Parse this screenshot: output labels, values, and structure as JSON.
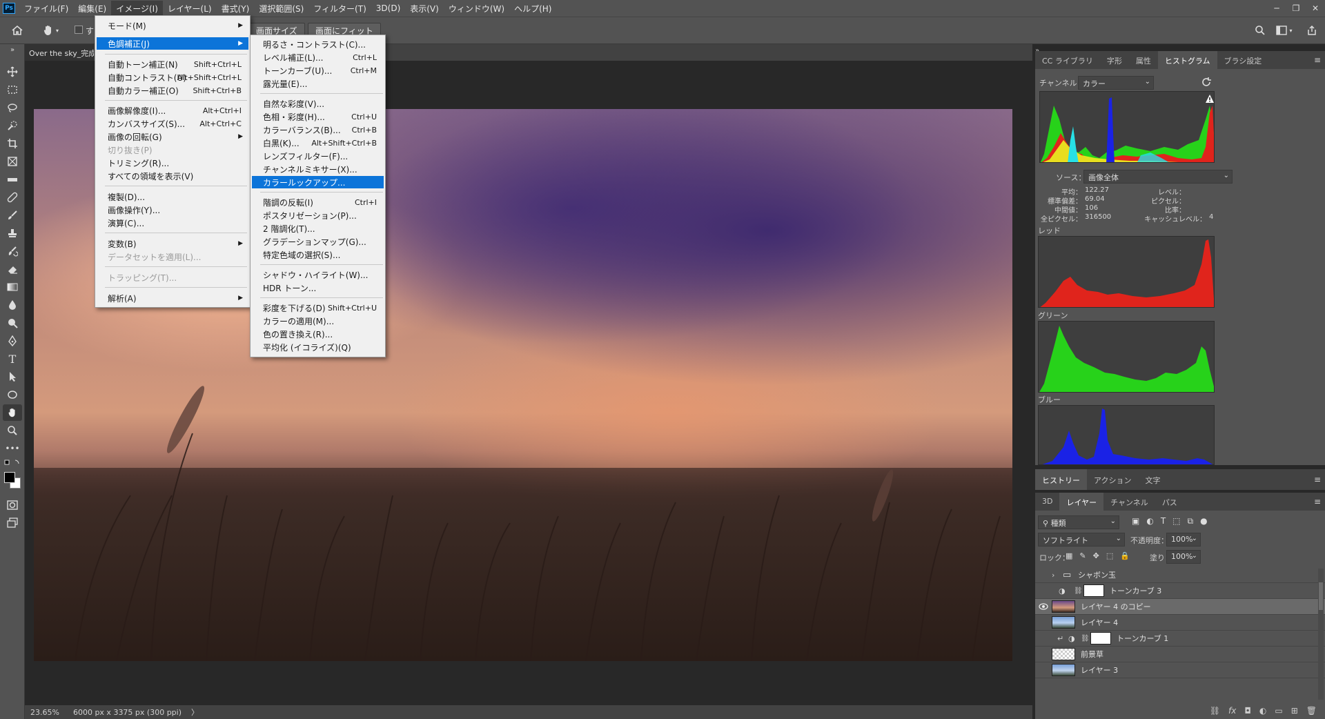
{
  "app": {
    "logo": "Ps"
  },
  "menubar": {
    "items": [
      "ファイル(F)",
      "編集(E)",
      "イメージ(I)",
      "レイヤー(L)",
      "書式(Y)",
      "選択範囲(S)",
      "フィルター(T)",
      "3D(D)",
      "表示(V)",
      "ウィンドウ(W)",
      "ヘルプ(H)"
    ],
    "window_controls": [
      "─",
      "❐",
      "✕"
    ]
  },
  "options": {
    "home_icon": "home-icon",
    "hand_icon": "hand-icon",
    "checkbox_label": "す",
    "btn_fit_size": "画面サイズ",
    "btn_fit_screen": "画面にフィット"
  },
  "document": {
    "tab_title": "Over the sky_完成",
    "zoom": "23.65%",
    "dimensions": "6000 px x 3375 px (300 ppi)",
    "status_arrow": "〉"
  },
  "image_menu": {
    "items": [
      {
        "label": "モード(M)",
        "submenu": true
      },
      {
        "label": "色調補正(J)",
        "submenu": true,
        "highlight": true
      },
      {
        "label": "自動トーン補正(N)",
        "shortcut": "Shift+Ctrl+L"
      },
      {
        "label": "自動コントラスト(U)",
        "shortcut": "Alt+Shift+Ctrl+L"
      },
      {
        "label": "自動カラー補正(O)",
        "shortcut": "Shift+Ctrl+B"
      },
      {
        "label": "画像解像度(I)...",
        "shortcut": "Alt+Ctrl+I"
      },
      {
        "label": "カンバスサイズ(S)...",
        "shortcut": "Alt+Ctrl+C"
      },
      {
        "label": "画像の回転(G)",
        "submenu": true
      },
      {
        "label": "切り抜き(P)",
        "disabled": true
      },
      {
        "label": "トリミング(R)..."
      },
      {
        "label": "すべての領域を表示(V)"
      },
      {
        "label": "複製(D)..."
      },
      {
        "label": "画像操作(Y)..."
      },
      {
        "label": "演算(C)..."
      },
      {
        "label": "変数(B)",
        "submenu": true
      },
      {
        "label": "データセットを適用(L)...",
        "disabled": true
      },
      {
        "label": "トラッピング(T)...",
        "disabled": true
      },
      {
        "label": "解析(A)",
        "submenu": true
      }
    ]
  },
  "adjust_menu": {
    "items": [
      {
        "label": "明るさ・コントラスト(C)..."
      },
      {
        "label": "レベル補正(L)...",
        "shortcut": "Ctrl+L"
      },
      {
        "label": "トーンカーブ(U)...",
        "shortcut": "Ctrl+M"
      },
      {
        "label": "露光量(E)..."
      },
      {
        "label": "自然な彩度(V)..."
      },
      {
        "label": "色相・彩度(H)...",
        "shortcut": "Ctrl+U"
      },
      {
        "label": "カラーバランス(B)...",
        "shortcut": "Ctrl+B"
      },
      {
        "label": "白黒(K)...",
        "shortcut": "Alt+Shift+Ctrl+B"
      },
      {
        "label": "レンズフィルター(F)..."
      },
      {
        "label": "チャンネルミキサー(X)..."
      },
      {
        "label": "カラールックアップ...",
        "highlight": true
      },
      {
        "label": "階調の反転(I)",
        "shortcut": "Ctrl+I"
      },
      {
        "label": "ポスタリゼーション(P)..."
      },
      {
        "label": "2 階調化(T)..."
      },
      {
        "label": "グラデーションマップ(G)..."
      },
      {
        "label": "特定色域の選択(S)..."
      },
      {
        "label": "シャドウ・ハイライト(W)..."
      },
      {
        "label": "HDR トーン..."
      },
      {
        "label": "彩度を下げる(D)",
        "shortcut": "Shift+Ctrl+U"
      },
      {
        "label": "カラーの適用(M)..."
      },
      {
        "label": "色の置き換え(R)..."
      },
      {
        "label": "平均化 (イコライズ)(Q)"
      }
    ]
  },
  "histogram_panel": {
    "tabs": [
      "CC ライブラリ",
      "字形",
      "属性",
      "ヒストグラム",
      "ブラシ設定"
    ],
    "active_tab": "ヒストグラム",
    "channel_label": "チャンネル：",
    "channel_value": "カラー",
    "source_label": "ソース：",
    "source_value": "画像全体",
    "stats": {
      "mean_label": "平均：",
      "mean": "122.27",
      "stddev_label": "標準偏差：",
      "stddev": "69.04",
      "median_label": "中間値：",
      "median": "106",
      "pixels_label": "全ピクセル：",
      "pixels": "316500",
      "level_label": "レベル：",
      "level": "",
      "count_label": "ピクセル：",
      "count": "",
      "percentile_label": "比率：",
      "percentile": "",
      "cache_label": "キャッシュレベル：",
      "cache": "4"
    },
    "channels": [
      "レッド",
      "グリーン",
      "ブルー"
    ],
    "colors": {
      "red": "#e0241c",
      "green": "#27d21a",
      "blue": "#1a22e6",
      "yellow": "#e8e820",
      "cyan": "#27e0e6"
    }
  },
  "history_panel": {
    "tabs": [
      "ヒストリー",
      "アクション",
      "文字"
    ],
    "active_tab": "ヒストリー"
  },
  "layers_panel": {
    "tabs": [
      "3D",
      "レイヤー",
      "チャンネル",
      "パス"
    ],
    "active_tab": "レイヤー",
    "filter_value": "種類",
    "blend_mode": "ソフトライト",
    "opacity_label": "不透明度：",
    "opacity": "100%",
    "lock_label": "ロック：",
    "fill_label": "塗り：",
    "fill": "100%",
    "layers": [
      {
        "name": "シャボン玉",
        "type": "group",
        "visible": false
      },
      {
        "name": "トーンカーブ 3",
        "type": "adjustment",
        "visible": false
      },
      {
        "name": "レイヤー 4 のコピー",
        "type": "image-warm",
        "visible": true,
        "selected": true
      },
      {
        "name": "レイヤー 4",
        "type": "image-sky",
        "visible": false
      },
      {
        "name": "トーンカーブ 1",
        "type": "adjustment-clipped",
        "visible": false
      },
      {
        "name": "前景草",
        "type": "transparent",
        "visible": false
      },
      {
        "name": "レイヤー 3",
        "type": "image-sky",
        "visible": false
      }
    ]
  }
}
